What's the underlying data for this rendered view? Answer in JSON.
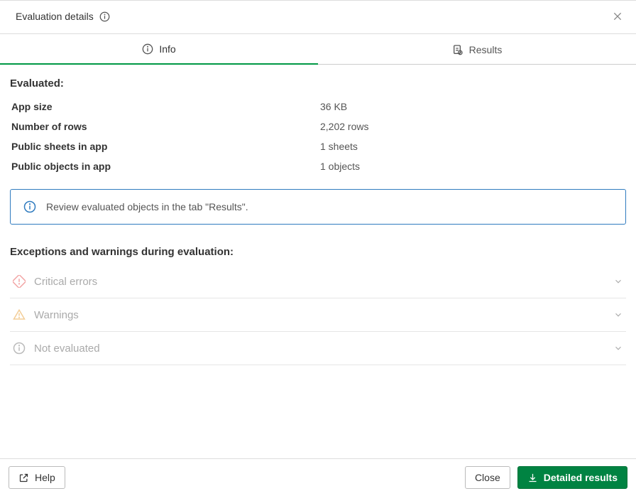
{
  "header": {
    "title": "Evaluation details"
  },
  "tabs": {
    "info": "Info",
    "results": "Results"
  },
  "evaluated": {
    "heading": "Evaluated:",
    "rows": [
      {
        "label": "App size",
        "value": "36 KB"
      },
      {
        "label": "Number of rows",
        "value": "2,202 rows"
      },
      {
        "label": "Public sheets in app",
        "value": "1 sheets"
      },
      {
        "label": "Public objects in app",
        "value": "1 objects"
      }
    ]
  },
  "banner": {
    "text": "Review evaluated objects in the tab \"Results\"."
  },
  "exceptions": {
    "heading": "Exceptions and warnings during evaluation:",
    "items": {
      "critical": "Critical errors",
      "warnings": "Warnings",
      "not_evaluated": "Not evaluated"
    }
  },
  "footer": {
    "help": "Help",
    "close": "Close",
    "detailed": "Detailed results"
  }
}
